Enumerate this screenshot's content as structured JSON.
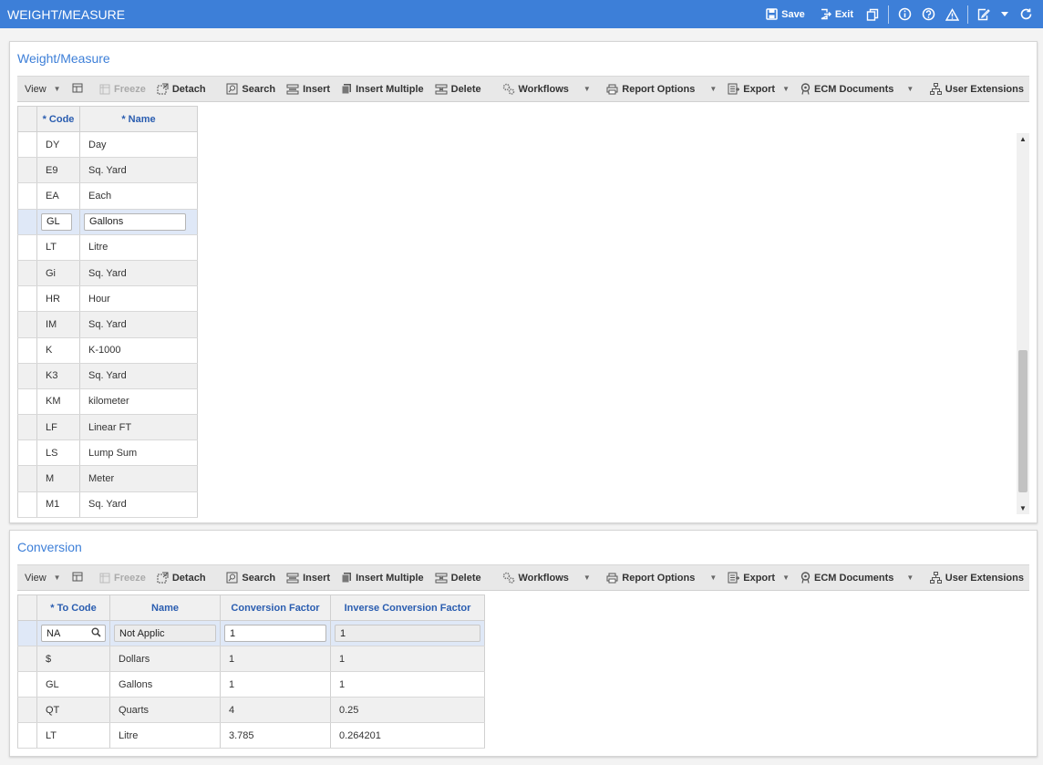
{
  "window": {
    "title": "WEIGHT/MEASURE",
    "save_label": "Save",
    "exit_label": "Exit"
  },
  "top_panel": {
    "title": "Weight/Measure",
    "toolbar": {
      "view": "View",
      "freeze": "Freeze",
      "detach": "Detach",
      "search": "Search",
      "insert": "Insert",
      "insert_multiple": "Insert Multiple",
      "delete": "Delete",
      "workflows": "Workflows",
      "report_options": "Report Options",
      "export": "Export",
      "ecm_documents": "ECM Documents",
      "user_extensions": "User Extensions"
    },
    "columns": [
      "* Code",
      "* Name"
    ],
    "rows": [
      {
        "code": "DY",
        "name": "Day"
      },
      {
        "code": "E9",
        "name": "Sq. Yard"
      },
      {
        "code": "EA",
        "name": "Each"
      },
      {
        "code": "GL",
        "name": "Gallons"
      },
      {
        "code": "LT",
        "name": "Litre"
      },
      {
        "code": "Gi",
        "name": "Sq. Yard"
      },
      {
        "code": "HR",
        "name": "Hour"
      },
      {
        "code": "IM",
        "name": "Sq. Yard"
      },
      {
        "code": "K",
        "name": "K-1000"
      },
      {
        "code": "K3",
        "name": "Sq. Yard"
      },
      {
        "code": "KM",
        "name": "kilometer"
      },
      {
        "code": "LF",
        "name": "Linear FT"
      },
      {
        "code": "LS",
        "name": "Lump Sum"
      },
      {
        "code": "M",
        "name": "Meter"
      },
      {
        "code": "M1",
        "name": "Sq. Yard"
      }
    ],
    "active_row": 3
  },
  "bottom_panel": {
    "title": "Conversion",
    "toolbar": {
      "view": "View",
      "freeze": "Freeze",
      "detach": "Detach",
      "search": "Search",
      "insert": "Insert",
      "insert_multiple": "Insert Multiple",
      "delete": "Delete",
      "workflows": "Workflows",
      "report_options": "Report Options",
      "export": "Export",
      "ecm_documents": "ECM Documents",
      "user_extensions": "User Extensions"
    },
    "columns": [
      "* To Code",
      "Name",
      "Conversion Factor",
      "Inverse Conversion Factor"
    ],
    "edit_row": {
      "to_code": "NA",
      "name": "Not Applic",
      "factor": "1",
      "inverse": "1"
    },
    "rows": [
      {
        "to_code": "$",
        "name": "Dollars",
        "factor": "1",
        "inverse": "1"
      },
      {
        "to_code": "GL",
        "name": "Gallons",
        "factor": "1",
        "inverse": "1"
      },
      {
        "to_code": "QT",
        "name": "Quarts",
        "factor": "4",
        "inverse": "0.25"
      },
      {
        "to_code": "LT",
        "name": "Litre",
        "factor": "3.785",
        "inverse": "0.264201"
      }
    ]
  },
  "colors": {
    "title_bar": "#3d7fd8",
    "panel_title": "#3d7fd8",
    "header_text": "#2a5db0",
    "active_row": "#dfe8f7"
  }
}
